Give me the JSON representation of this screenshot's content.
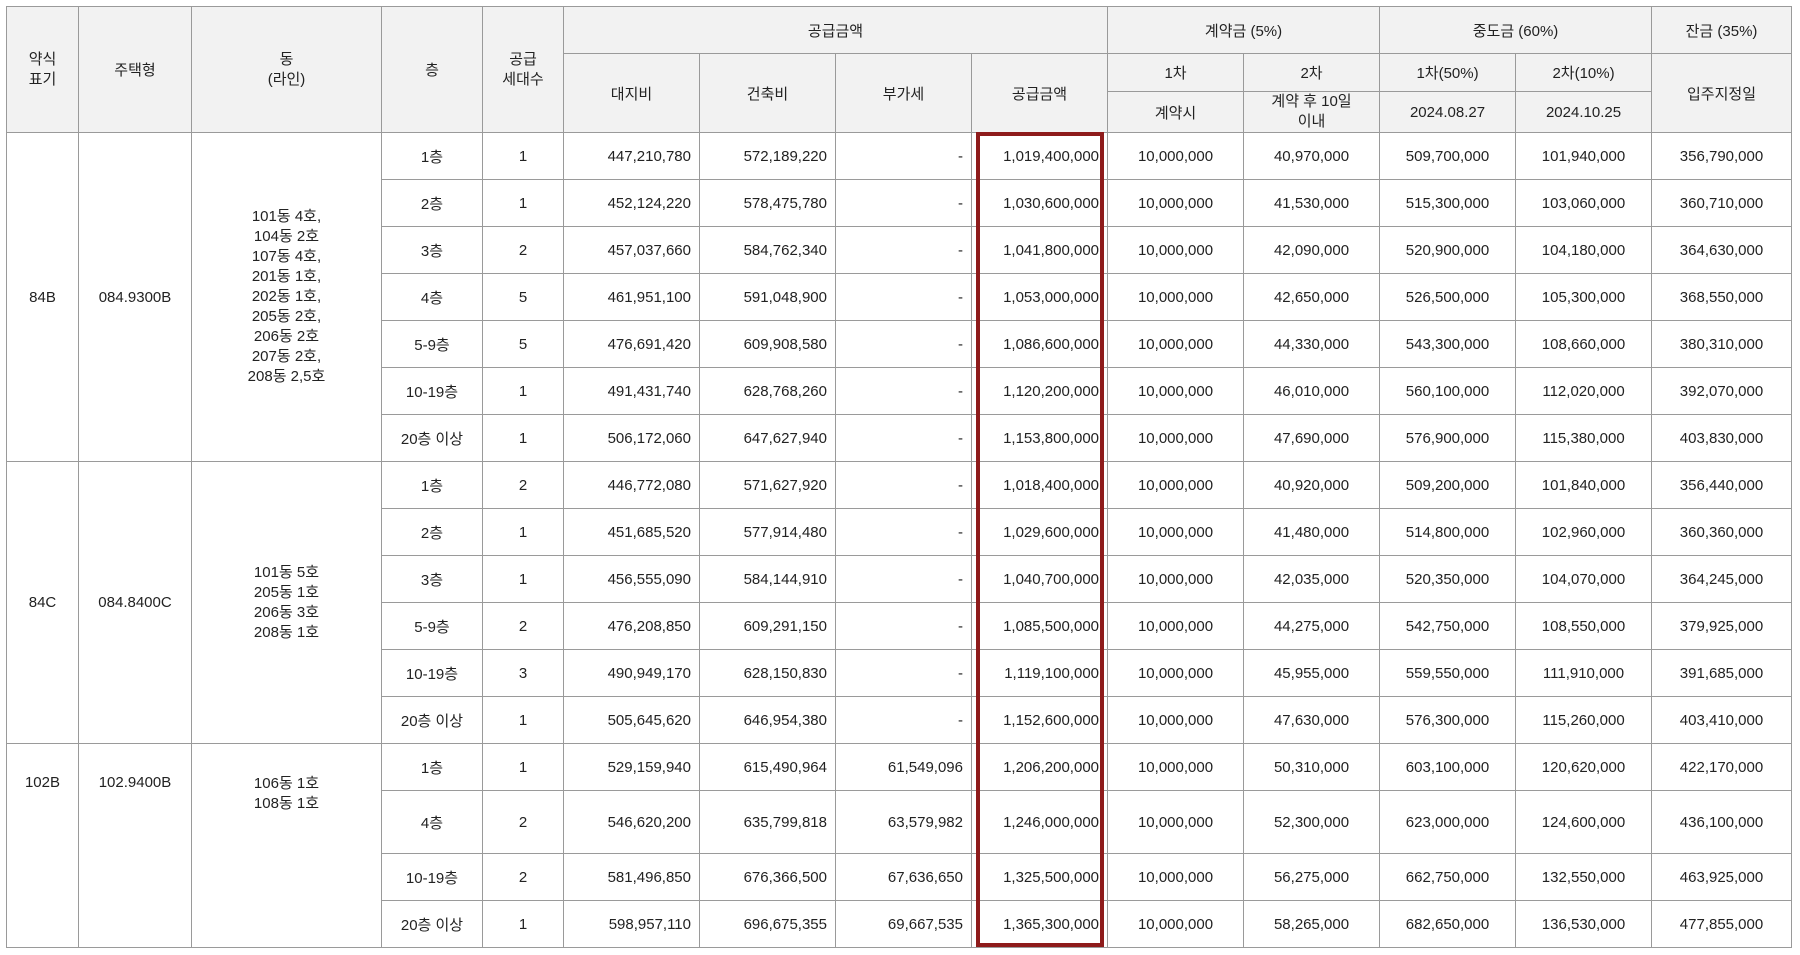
{
  "header": {
    "abbr": "약식\n표기",
    "housing_type": "주택형",
    "dong": "동\n(라인)",
    "floor": "층",
    "supply_units": "공급\n세대수",
    "supply_amount_group": "공급금액",
    "land": "대지비",
    "building": "건축비",
    "vat": "부가세",
    "supply_amount": "공급금액",
    "contract_group": "계약금 (5%)",
    "contract_1st": "1차",
    "contract_2nd": "2차",
    "contract_1st_when": "계약시",
    "contract_2nd_when": "계약 후 10일\n이내",
    "interim_group": "중도금 (60%)",
    "interim_1st": "1차(50%)",
    "interim_2nd": "2차(10%)",
    "interim_1st_date": "2024.08.27",
    "interim_2nd_date": "2024.10.25",
    "balance_group": "잔금 (35%)",
    "balance_when": "입주지정일"
  },
  "groups": [
    {
      "abbr": "84B",
      "type": "084.9300B",
      "dong": "101동 4호,\n104동 2호\n107동 4호,\n201동 1호,\n202동 1호,\n205동 2호,\n206동 2호\n207동 2호,\n208동 2,5호",
      "rows": [
        {
          "floor": "1층",
          "units": "1",
          "land": "447,210,780",
          "building": "572,189,220",
          "vat": "-",
          "supply": "1,019,400,000",
          "c1": "10,000,000",
          "c2": "40,970,000",
          "i1": "509,700,000",
          "i2": "101,940,000",
          "bal": "356,790,000"
        },
        {
          "floor": "2층",
          "units": "1",
          "land": "452,124,220",
          "building": "578,475,780",
          "vat": "-",
          "supply": "1,030,600,000",
          "c1": "10,000,000",
          "c2": "41,530,000",
          "i1": "515,300,000",
          "i2": "103,060,000",
          "bal": "360,710,000"
        },
        {
          "floor": "3층",
          "units": "2",
          "land": "457,037,660",
          "building": "584,762,340",
          "vat": "-",
          "supply": "1,041,800,000",
          "c1": "10,000,000",
          "c2": "42,090,000",
          "i1": "520,900,000",
          "i2": "104,180,000",
          "bal": "364,630,000"
        },
        {
          "floor": "4층",
          "units": "5",
          "land": "461,951,100",
          "building": "591,048,900",
          "vat": "-",
          "supply": "1,053,000,000",
          "c1": "10,000,000",
          "c2": "42,650,000",
          "i1": "526,500,000",
          "i2": "105,300,000",
          "bal": "368,550,000"
        },
        {
          "floor": "5-9층",
          "units": "5",
          "land": "476,691,420",
          "building": "609,908,580",
          "vat": "-",
          "supply": "1,086,600,000",
          "c1": "10,000,000",
          "c2": "44,330,000",
          "i1": "543,300,000",
          "i2": "108,660,000",
          "bal": "380,310,000"
        },
        {
          "floor": "10-19층",
          "units": "1",
          "land": "491,431,740",
          "building": "628,768,260",
          "vat": "-",
          "supply": "1,120,200,000",
          "c1": "10,000,000",
          "c2": "46,010,000",
          "i1": "560,100,000",
          "i2": "112,020,000",
          "bal": "392,070,000"
        },
        {
          "floor": "20층 이상",
          "units": "1",
          "land": "506,172,060",
          "building": "647,627,940",
          "vat": "-",
          "supply": "1,153,800,000",
          "c1": "10,000,000",
          "c2": "47,690,000",
          "i1": "576,900,000",
          "i2": "115,380,000",
          "bal": "403,830,000"
        }
      ]
    },
    {
      "abbr": "84C",
      "type": "084.8400C",
      "dong": "101동 5호\n205동 1호\n206동 3호\n208동 1호",
      "rows": [
        {
          "floor": "1층",
          "units": "2",
          "land": "446,772,080",
          "building": "571,627,920",
          "vat": "-",
          "supply": "1,018,400,000",
          "c1": "10,000,000",
          "c2": "40,920,000",
          "i1": "509,200,000",
          "i2": "101,840,000",
          "bal": "356,440,000"
        },
        {
          "floor": "2층",
          "units": "1",
          "land": "451,685,520",
          "building": "577,914,480",
          "vat": "-",
          "supply": "1,029,600,000",
          "c1": "10,000,000",
          "c2": "41,480,000",
          "i1": "514,800,000",
          "i2": "102,960,000",
          "bal": "360,360,000"
        },
        {
          "floor": "3층",
          "units": "1",
          "land": "456,555,090",
          "building": "584,144,910",
          "vat": "-",
          "supply": "1,040,700,000",
          "c1": "10,000,000",
          "c2": "42,035,000",
          "i1": "520,350,000",
          "i2": "104,070,000",
          "bal": "364,245,000"
        },
        {
          "floor": "5-9층",
          "units": "2",
          "land": "476,208,850",
          "building": "609,291,150",
          "vat": "-",
          "supply": "1,085,500,000",
          "c1": "10,000,000",
          "c2": "44,275,000",
          "i1": "542,750,000",
          "i2": "108,550,000",
          "bal": "379,925,000"
        },
        {
          "floor": "10-19층",
          "units": "3",
          "land": "490,949,170",
          "building": "628,150,830",
          "vat": "-",
          "supply": "1,119,100,000",
          "c1": "10,000,000",
          "c2": "45,955,000",
          "i1": "559,550,000",
          "i2": "111,910,000",
          "bal": "391,685,000"
        },
        {
          "floor": "20층 이상",
          "units": "1",
          "land": "505,645,620",
          "building": "646,954,380",
          "vat": "-",
          "supply": "1,152,600,000",
          "c1": "10,000,000",
          "c2": "47,630,000",
          "i1": "576,300,000",
          "i2": "115,260,000",
          "bal": "403,410,000"
        }
      ]
    },
    {
      "abbr": "102B",
      "type": "102.9400B",
      "dong": "106동 1호\n108동 1호",
      "rows": [
        {
          "floor": "1층",
          "units": "1",
          "land": "529,159,940",
          "building": "615,490,964",
          "vat": "61,549,096",
          "supply": "1,206,200,000",
          "c1": "10,000,000",
          "c2": "50,310,000",
          "i1": "603,100,000",
          "i2": "120,620,000",
          "bal": "422,170,000"
        },
        {
          "floor": "4층",
          "units": "2",
          "land": "546,620,200",
          "building": "635,799,818",
          "vat": "63,579,982",
          "supply": "1,246,000,000",
          "c1": "10,000,000",
          "c2": "52,300,000",
          "i1": "623,000,000",
          "i2": "124,600,000",
          "bal": "436,100,000"
        },
        {
          "floor": "10-19층",
          "units": "2",
          "land": "581,496,850",
          "building": "676,366,500",
          "vat": "67,636,650",
          "supply": "1,325,500,000",
          "c1": "10,000,000",
          "c2": "56,275,000",
          "i1": "662,750,000",
          "i2": "132,550,000",
          "bal": "463,925,000"
        },
        {
          "floor": "20층 이상",
          "units": "1",
          "land": "598,957,110",
          "building": "696,675,355",
          "vat": "69,667,535",
          "supply": "1,365,300,000",
          "c1": "10,000,000",
          "c2": "58,265,000",
          "i1": "682,650,000",
          "i2": "136,530,000",
          "bal": "477,855,000"
        }
      ]
    }
  ],
  "highlight_color": "#8e1b1b"
}
